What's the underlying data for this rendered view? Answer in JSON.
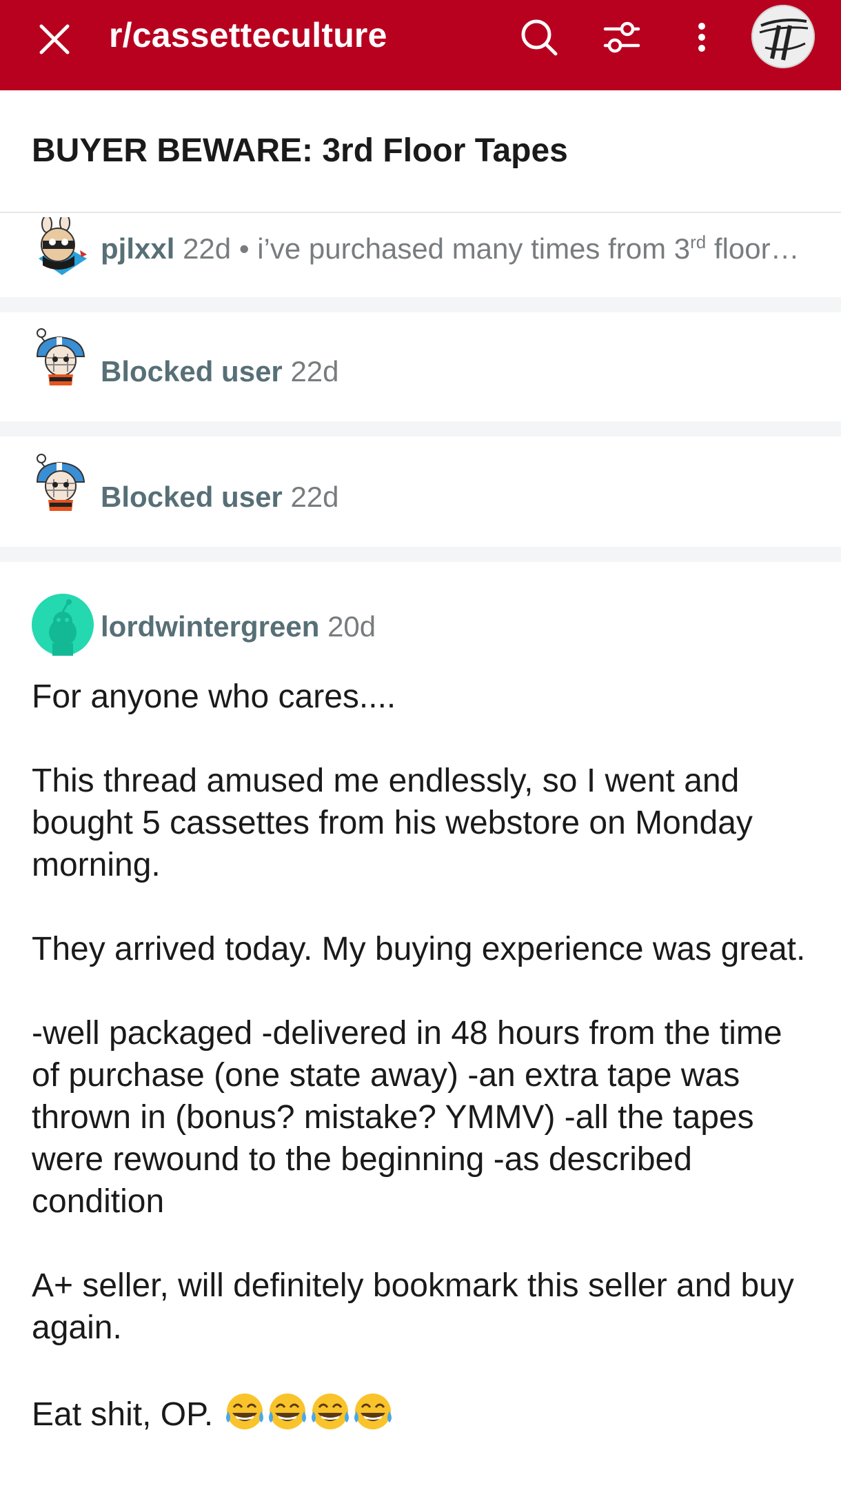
{
  "header": {
    "subreddit": "r/cassetteculture",
    "icons": [
      "close-icon",
      "search-icon",
      "filter-icon",
      "more-vertical-icon",
      "avatar"
    ],
    "brand_color": "#b8001f"
  },
  "post": {
    "title": "BUYER BEWARE: 3rd Floor Tapes"
  },
  "comments": [
    {
      "username": "pjlxxl",
      "age": "22d",
      "separator": "•",
      "snippet_pre": "i’ve purchased many times from 3",
      "snippet_sup": "rd",
      "snippet_post": " floor…"
    },
    {
      "username": "Blocked user",
      "age": "22d"
    },
    {
      "username": "Blocked user",
      "age": "22d"
    },
    {
      "username": "lordwintergreen",
      "age": "20d",
      "paragraphs": [
        "For anyone who cares....",
        "This thread amused me endlessly, so I went and bought 5 cassettes from his webstore on Monday morning.",
        "They arrived today. My buying experience was great.",
        "-well packaged -delivered in 48 hours from the time of purchase (one state away) -an extra tape was thrown in (bonus? mistake? YMMV) -all the tapes were rewound to the beginning -as described condition",
        "A+ seller, will definitely bookmark this seller and buy again.",
        "Eat shit, OP."
      ],
      "emoji": [
        "laughing-tears-emoji",
        "laughing-tears-emoji",
        "laughing-tears-emoji",
        "laughing-tears-emoji"
      ]
    }
  ]
}
